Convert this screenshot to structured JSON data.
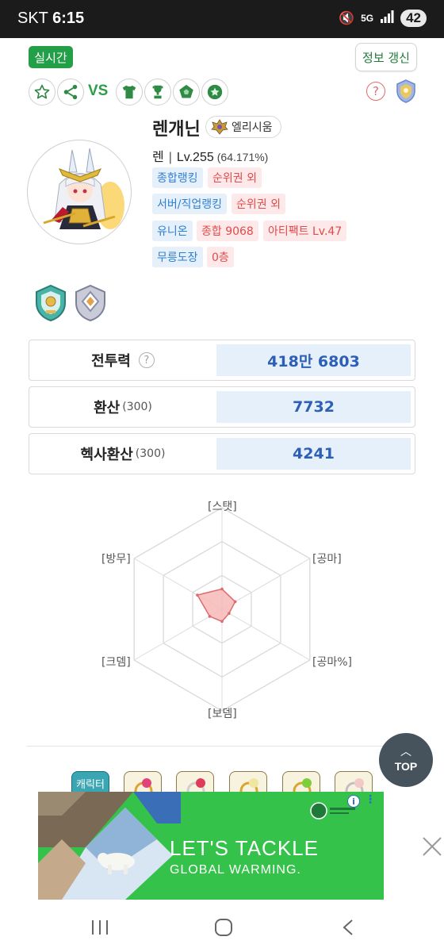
{
  "status_bar": {
    "carrier": "SKT",
    "time": "6:15",
    "network": "5G",
    "battery": "42"
  },
  "header": {
    "live_label": "실시간",
    "refresh_label": "정보 갱신",
    "vs_label": "VS",
    "help_symbol": "?"
  },
  "character": {
    "name": "렌개닌",
    "guild": "엘리시움",
    "job": "렌",
    "separator": "|",
    "level": "Lv.255",
    "exp_percent": "(64.171%)",
    "tags": [
      {
        "text": "종합랭킹",
        "color": "blue"
      },
      {
        "text": "순위권 외",
        "color": "red"
      },
      {
        "text": "서버/직업랭킹",
        "color": "blue"
      },
      {
        "text": "순위권 외",
        "color": "red"
      },
      {
        "text": "유니온",
        "color": "blue"
      },
      {
        "text": "종합 9068",
        "color": "red"
      },
      {
        "text": "아티팩트 Lv.47",
        "color": "red"
      },
      {
        "text": "무릉도장",
        "color": "blue"
      },
      {
        "text": "0층",
        "color": "red"
      }
    ]
  },
  "stats": [
    {
      "label": "전투력",
      "sub": "",
      "value": "418만 6803",
      "help": "?"
    },
    {
      "label": "환산",
      "sub": "(300)",
      "value": "7732"
    },
    {
      "label": "헥사환산",
      "sub": "(300)",
      "value": "4241"
    }
  ],
  "radar": {
    "axes": [
      "[스탯]",
      "[공마]",
      "[공마%]",
      "[보뎀]",
      "[크뎀]",
      "[방무]"
    ],
    "values": [
      0.2,
      0.15,
      0.08,
      0.12,
      0.14,
      0.28
    ],
    "rings": 3,
    "fill_color": "#f6b9b9",
    "stroke_color": "#e06a6a"
  },
  "equipment_first_label": "캐릭터",
  "top_button": {
    "label": "TOP"
  },
  "ad": {
    "title": "LET'S TACKLE",
    "subtitle": "GLOBAL WARMING.",
    "info_symbol": "i",
    "more_symbol": "⋮"
  },
  "colors": {
    "brand_green": "#23a047",
    "value_blue": "#2c5fb5",
    "tag_blue": "#2f7fd0",
    "tag_red": "#e24a4a",
    "ad_green": "#35c24b"
  }
}
